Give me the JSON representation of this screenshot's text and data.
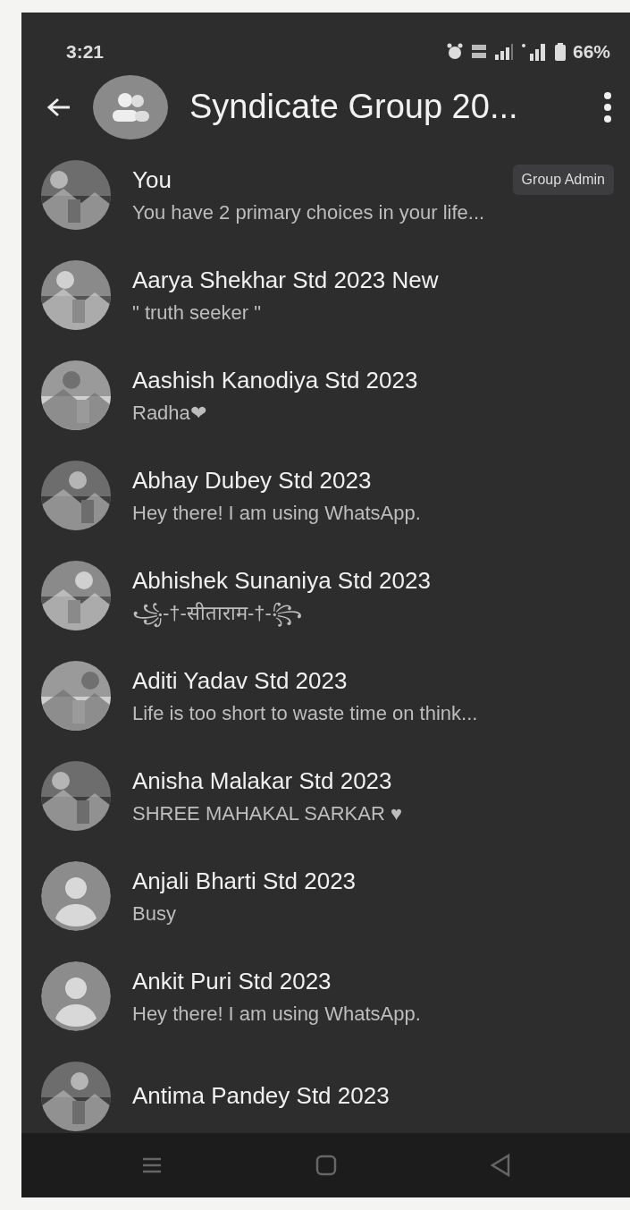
{
  "status_bar": {
    "time": "3:21",
    "battery": "66%"
  },
  "header": {
    "title": "Syndicate Group 20..."
  },
  "participants": [
    {
      "name": "You",
      "about": "You have 2 primary choices in your life...",
      "badge": "Group Admin"
    },
    {
      "name": "Aarya Shekhar Std 2023 New",
      "about": "\" truth seeker \""
    },
    {
      "name": "Aashish Kanodiya Std 2023",
      "about": "Radha❤"
    },
    {
      "name": "Abhay Dubey Std 2023",
      "about": "Hey there! I am using WhatsApp."
    },
    {
      "name": "Abhishek Sunaniya Std 2023",
      "about": "꧁-†-सीताराम-†-꧂"
    },
    {
      "name": "Aditi Yadav Std 2023",
      "about": "Life is too short to waste time on think..."
    },
    {
      "name": "Anisha Malakar Std 2023",
      "about": "SHREE MAHAKAL SARKAR ♥"
    },
    {
      "name": "Anjali Bharti Std 2023",
      "about": "Busy",
      "kind": "default"
    },
    {
      "name": "Ankit Puri Std 2023",
      "about": "Hey there! I am using WhatsApp.",
      "kind": "default"
    },
    {
      "name": "Antima Pandey Std 2023"
    }
  ]
}
